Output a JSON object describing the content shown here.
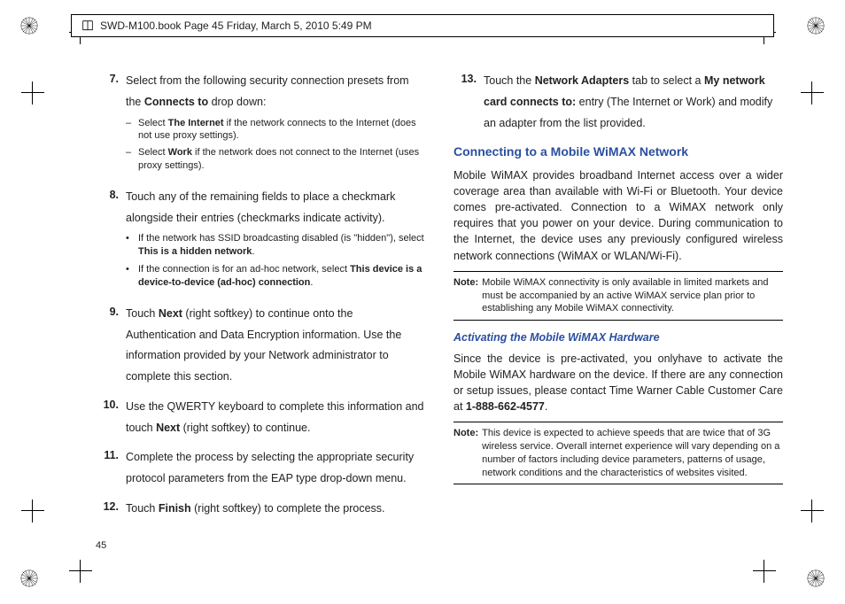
{
  "header": "SWD-M100.book  Page 45  Friday, March 5, 2010  5:49 PM",
  "page_number": "45",
  "left": {
    "step7": {
      "text_a": "Select from the following security connection presets from the ",
      "bold_a": "Connects to",
      "text_b": " drop down:",
      "dash1_a": "Select ",
      "dash1_bold": "The Internet",
      "dash1_b": " if the network connects to the Internet (does not use proxy settings).",
      "dash2_a": "Select ",
      "dash2_bold": "Work",
      "dash2_b": " if the network does not connect to the Internet (uses proxy settings)."
    },
    "step8": {
      "text": "Touch any of the remaining fields to place a checkmark alongside their entries (checkmarks indicate activity).",
      "bullet1_a": "If the network has SSID broadcasting disabled (is \"hidden\"), select ",
      "bullet1_bold": "This is a hidden network",
      "bullet1_b": ".",
      "bullet2_a": "If the connection is for an ad-hoc network, select ",
      "bullet2_bold": "This device is a device-to-device (ad-hoc) connection",
      "bullet2_b": "."
    },
    "step9": {
      "a": "Touch ",
      "bold": "Next",
      "b": " (right softkey) to continue onto the Authentication and Data Encryption information. Use the information provided by your Network administrator to complete this section."
    },
    "step10": {
      "a": "Use the QWERTY keyboard to complete this information and touch ",
      "bold": "Next",
      "b": " (right softkey) to continue."
    },
    "step11": "Complete the process by selecting the appropriate security protocol parameters from the EAP type drop-down menu.",
    "step12": {
      "a": "Touch ",
      "bold": "Finish",
      "b": " (right softkey) to complete the process."
    }
  },
  "right": {
    "step13": {
      "a": "Touch the ",
      "bold1": "Network Adapters",
      "b": " tab to select a ",
      "bold2": "My network card connects to:",
      "c": " entry (The Internet or Work) and modify an adapter from the list provided."
    },
    "heading1": "Connecting to a Mobile WiMAX Network",
    "para1": "Mobile WiMAX provides broadband Internet access over a wider coverage area than available with Wi-Fi or Bluetooth. Your device comes pre-activated.  Connection to a WiMAX network only requires that you power on your device. During communication to the Internet, the device uses any previously configured wireless network connections (WiMAX or WLAN/Wi-Fi).",
    "note1_label": "Note:",
    "note1_text": "Mobile WiMAX connectivity is only available in limited markets and must be accompanied by an active WiMAX service plan prior to establishing any Mobile WiMAX connectivity.",
    "heading2": "Activating the Mobile WiMAX Hardware",
    "para2_a": "Since the device is pre-activated, you onlyhave to activate the Mobile WiMAX hardware on the device.  If there are any connection or setup issues, please contact Time Warner Cable Customer Care at ",
    "para2_bold": "1-888-662-4577",
    "para2_b": ".",
    "note2_label": "Note:",
    "note2_text": "This device is expected to achieve speeds that are twice that of 3G wireless service. Overall internet experience will vary depending on a number of factors including device parameters, patterns of usage, network conditions and the characteristics of websites visited."
  }
}
